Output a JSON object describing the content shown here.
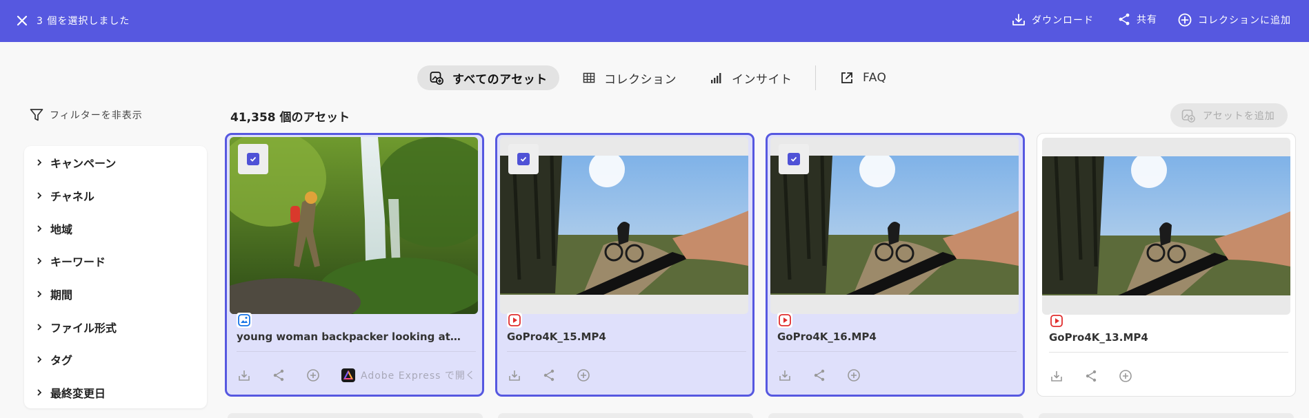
{
  "colors": {
    "accent": "#5658e0",
    "selected_card_bg": "#dfe0fb",
    "video_badge": "#e02d2d",
    "image_badge": "#1473e6"
  },
  "topbar": {
    "selection_text": "3 個を選択しました",
    "close_icon": "close-icon",
    "actions": [
      {
        "label": "ダウンロード",
        "icon": "download-icon"
      },
      {
        "label": "共有",
        "icon": "share-icon"
      },
      {
        "label": "コレクションに追加",
        "icon": "plus-circle-icon"
      }
    ]
  },
  "tabs": [
    {
      "label": "すべてのアセット",
      "icon": "assets-icon",
      "active": true
    },
    {
      "label": "コレクション",
      "icon": "grid-icon",
      "active": false
    },
    {
      "label": "インサイト",
      "icon": "bar-chart-icon",
      "active": false
    },
    {
      "label": "FAQ",
      "icon": "external-link-icon",
      "active": false
    }
  ],
  "filters": {
    "toggle_label": "フィルターを非表示",
    "items": [
      "キャンペーン",
      "チャネル",
      "地域",
      "キーワード",
      "期間",
      "ファイル形式",
      "タグ",
      "最終変更日"
    ]
  },
  "assets": {
    "count_label": "41,358 個のアセット",
    "add_button_label": "アセットを追加",
    "cards": [
      {
        "title": "young woman backpacker looking at the waterfall",
        "type": "image",
        "selected": true,
        "open_in_label": "Adobe Express で開く"
      },
      {
        "title": "GoPro4K_15.MP4",
        "type": "video",
        "selected": true
      },
      {
        "title": "GoPro4K_16.MP4",
        "type": "video",
        "selected": true
      },
      {
        "title": "GoPro4K_13.MP4",
        "type": "video",
        "selected": false
      }
    ]
  }
}
